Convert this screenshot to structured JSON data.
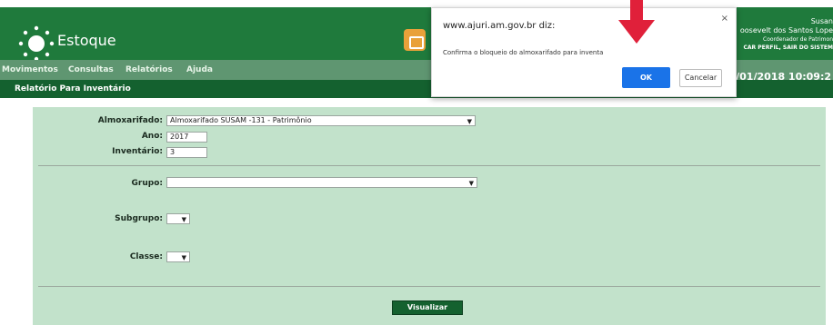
{
  "app": {
    "title": "Estoque"
  },
  "header": {
    "user": {
      "name": "Susan",
      "surname": "oosevelt dos Santos Lope",
      "role": "Coordenador de Patrimon",
      "links": "CAR PERFIL, SAIR DO SISTEM"
    },
    "datetime": "9/01/2018 10:09:2"
  },
  "menu": {
    "items": [
      "Movimentos",
      "Consultas",
      "Relatórios",
      "Ajuda"
    ]
  },
  "page": {
    "title": "Relatório Para Inventário"
  },
  "form": {
    "almoxarifado": {
      "label": "Almoxarifado:",
      "value": "Almoxarifado SUSAM -131 - Patrimônio"
    },
    "ano": {
      "label": "Ano:",
      "value": "2017"
    },
    "inventario": {
      "label": "Inventário:",
      "value": "3"
    },
    "grupo": {
      "label": "Grupo:",
      "value": ""
    },
    "subgrupo": {
      "label": "Subgrupo:",
      "value": ""
    },
    "classe": {
      "label": "Classe:",
      "value": ""
    },
    "submit_label": "Visualizar"
  },
  "dialog": {
    "title": "www.ajuri.am.gov.br diz:",
    "message": "Confirma o bloqueio do almoxarifado para inventa",
    "ok_label": "OK",
    "cancel_label": "Cancelar",
    "close_glyph": "×"
  },
  "colors": {
    "header_green": "#1f7a3c",
    "menu_green": "#5f9671",
    "panel_green": "#c2e2cb",
    "ok_blue": "#1a73e8",
    "annotation_red": "#e0203a"
  },
  "icons": [
    "logo-icon",
    "lockbox-icon",
    "dropdown-caret-icon",
    "close-icon",
    "red-arrow-annotation"
  ]
}
